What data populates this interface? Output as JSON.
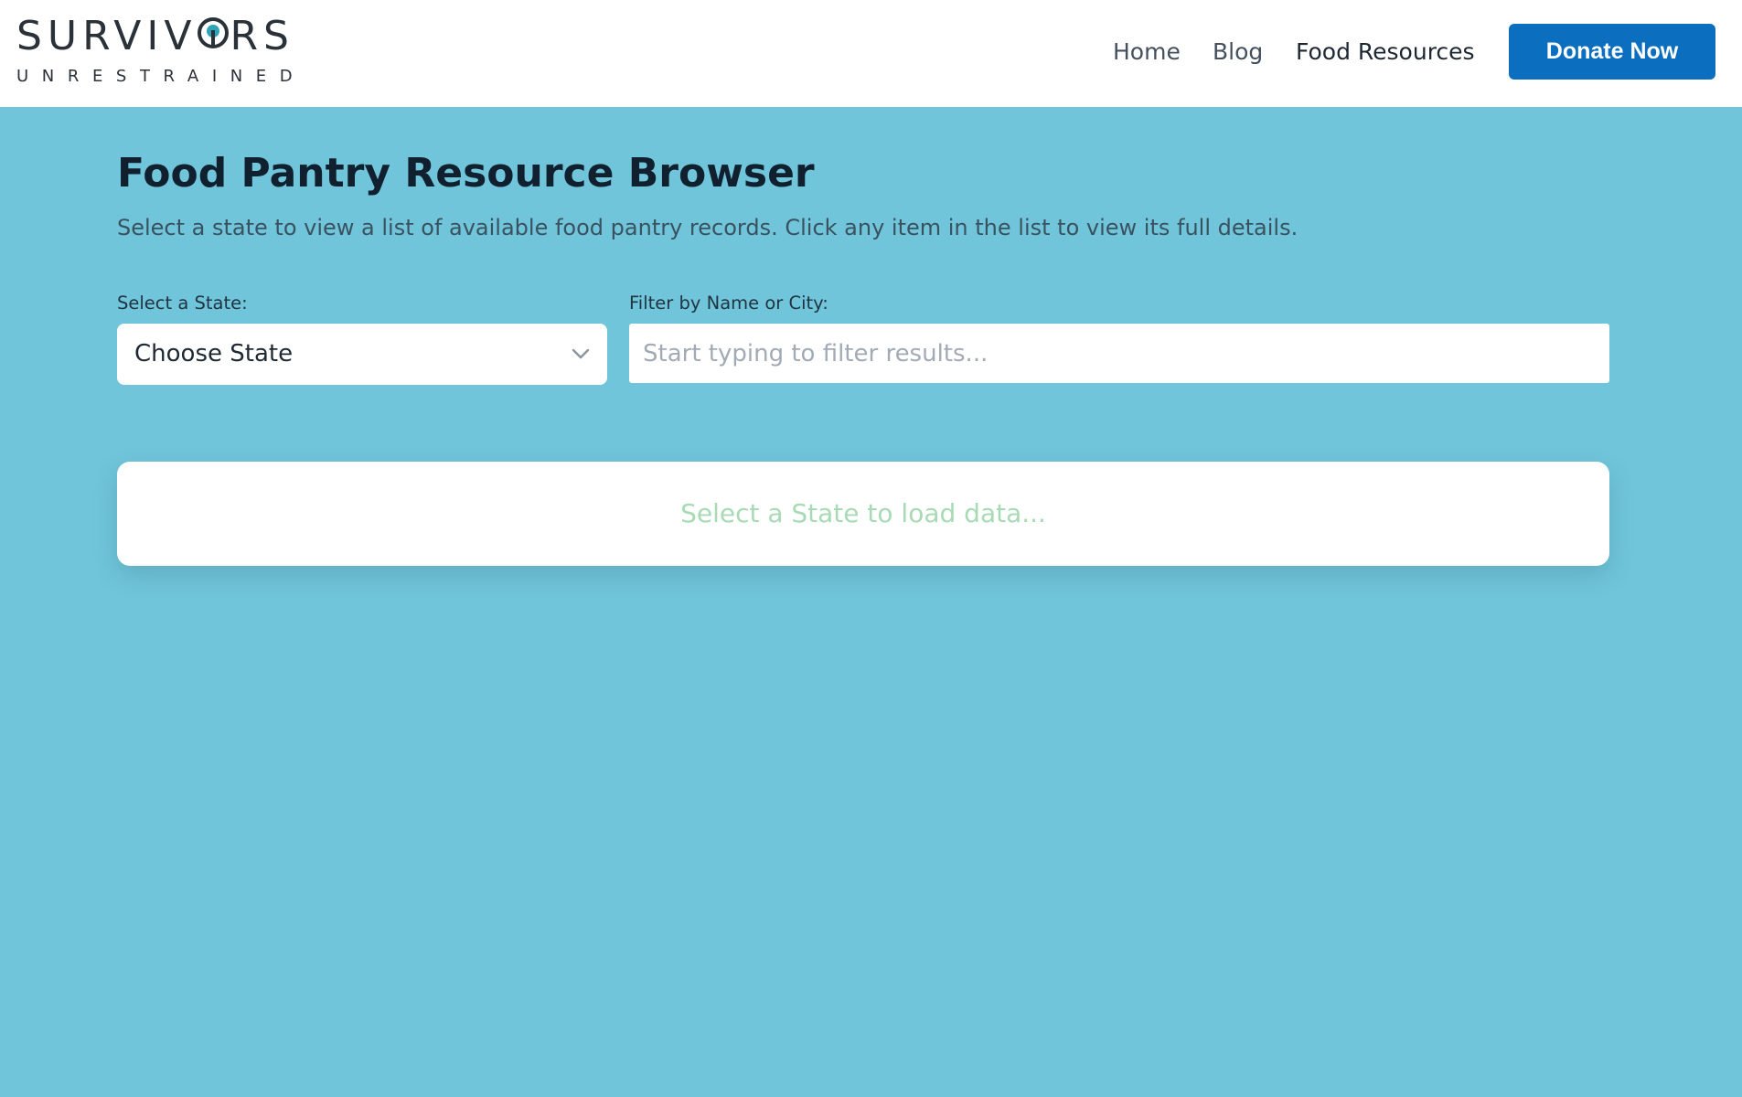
{
  "header": {
    "logo": {
      "top": "SURVIVORS",
      "top_before_ring": "SURVIV",
      "top_after_ring": "RS",
      "bottom": "UNRESTRAINED"
    },
    "nav": [
      {
        "label": "Home"
      },
      {
        "label": "Blog"
      },
      {
        "label": "Food Resources"
      }
    ],
    "donate_label": "Donate Now",
    "donate_color": "#0b6ebf"
  },
  "page": {
    "title": "Food Pantry Resource Browser",
    "subtitle": "Select a state to view a list of available food pantry records. Click any item in the list to view its full details."
  },
  "form": {
    "state_label": "Select a State:",
    "state_value": "Choose State",
    "filter_label": "Filter by Name or City:",
    "filter_placeholder": "Start typing to filter results..."
  },
  "results": {
    "message": "Select a State to load data..."
  },
  "colors": {
    "background": "#70c5da",
    "header": "#ffffff",
    "empty_message": "#a8dbb5"
  }
}
